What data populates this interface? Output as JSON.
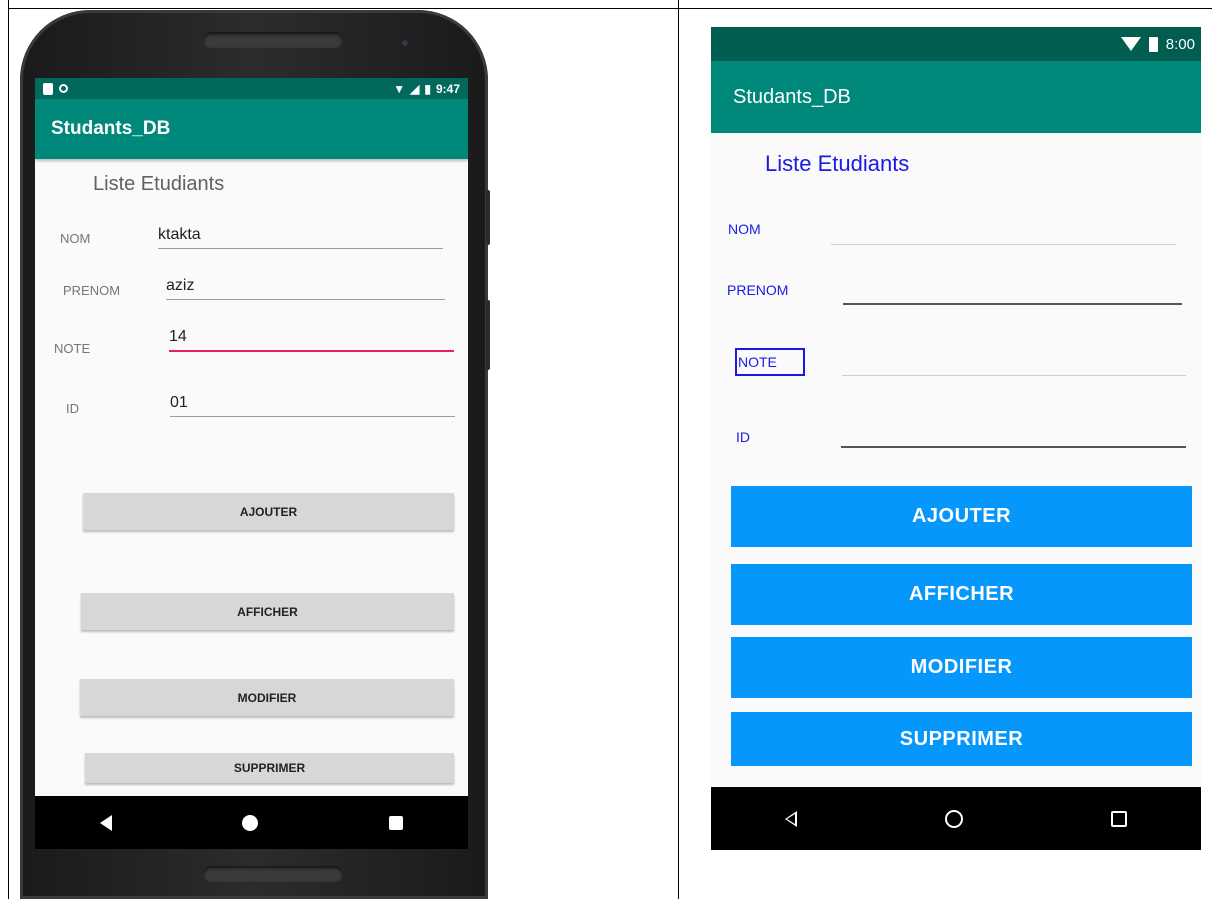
{
  "left_phone": {
    "status_bar": {
      "time": "9:47"
    },
    "toolbar_title": "Studants_DB",
    "screen_title": "Liste Etudiants",
    "fields": [
      {
        "label": "NOM",
        "value": "ktakta"
      },
      {
        "label": "PRENOM",
        "value": "aziz"
      },
      {
        "label": "NOTE",
        "value": "14"
      },
      {
        "label": "ID",
        "value": "01"
      }
    ],
    "buttons": [
      "AJOUTER",
      "AFFICHER",
      "MODIFIER",
      "SUPPRIMER"
    ]
  },
  "right_screen": {
    "status_bar": {
      "time": "8:00"
    },
    "toolbar_title": "Studants_DB",
    "screen_title": "Liste Etudiants",
    "labels": [
      "NOM",
      "PRENOM",
      "NOTE",
      "ID"
    ],
    "buttons": [
      "AJOUTER",
      "AFFICHER",
      "MODIFIER",
      "SUPPRIMER"
    ]
  },
  "colors": {
    "status_bar": "#00695c",
    "toolbar": "#00897b",
    "active_underline": "#e91e63",
    "right_button": "#0597fc",
    "right_text": "#1a1ae6"
  }
}
